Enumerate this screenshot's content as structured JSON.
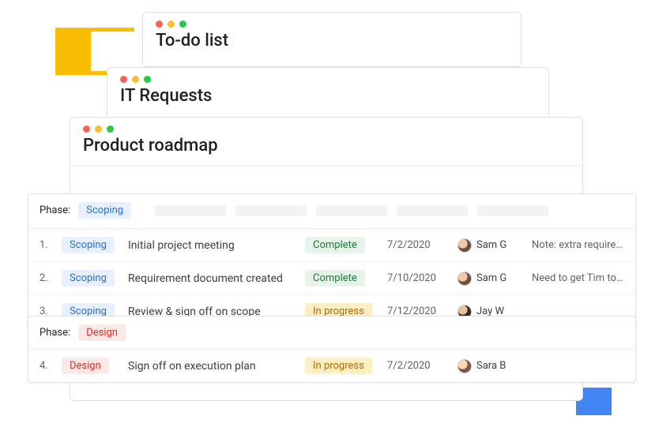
{
  "windows": {
    "back1_title": "To-do list",
    "back2_title": "IT Requests",
    "front_title": "Product roadmap"
  },
  "phase_label": "Phase:",
  "sections": [
    {
      "phase_name": "Scoping",
      "phase_class": "scoping",
      "rows": [
        {
          "num": "1.",
          "phase": "Scoping",
          "phase_class": "scoping",
          "title": "Initial project meeting",
          "status": "Complete",
          "status_class": "complete",
          "date": "7/2/2020",
          "owner": "Sam G",
          "avatar": "av1",
          "note": "Note: extra requirement to..."
        },
        {
          "num": "2.",
          "phase": "Scoping",
          "phase_class": "scoping",
          "title": "Requirement document created",
          "status": "Complete",
          "status_class": "complete",
          "date": "7/10/2020",
          "owner": "Sam G",
          "avatar": "av1",
          "note": "Need to get Tim to review"
        },
        {
          "num": "3.",
          "phase": "Scoping",
          "phase_class": "scoping",
          "title": "Review & sign off on scope",
          "status": "In progress",
          "status_class": "progress",
          "date": "7/12/2020",
          "owner": "Jay W",
          "avatar": "av2",
          "note": ""
        }
      ]
    },
    {
      "phase_name": "Design",
      "phase_class": "design",
      "rows": [
        {
          "num": "4.",
          "phase": "Design",
          "phase_class": "design",
          "title": "Sign off on execution plan",
          "status": "In progress",
          "status_class": "progress",
          "date": "7/2/2020",
          "owner": "Sara B",
          "avatar": "av3",
          "note": ""
        }
      ]
    }
  ]
}
